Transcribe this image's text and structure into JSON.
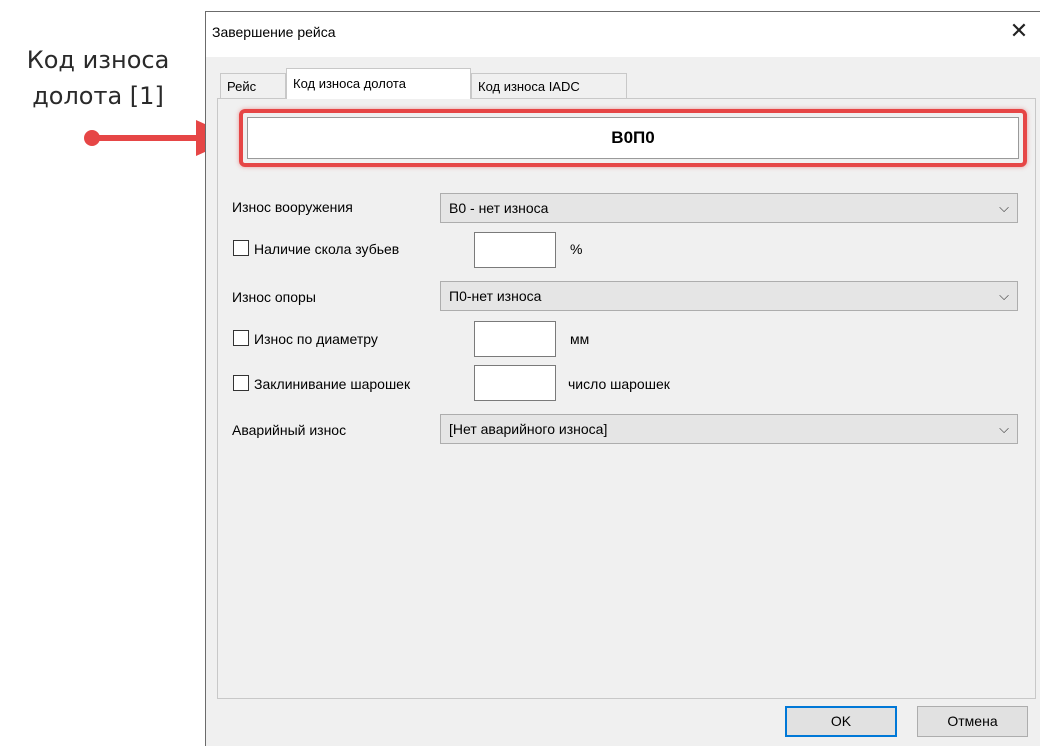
{
  "annotation": {
    "text_line1": "Код износа",
    "text_line2": "долота [1]"
  },
  "dialog": {
    "title": "Завершение рейса",
    "tabs": [
      {
        "label": "Рейс"
      },
      {
        "label": "Код износа долота",
        "active": true
      },
      {
        "label": "Код износа IADC"
      }
    ],
    "code_value": "В0П0",
    "fields": {
      "armament_wear": {
        "label": "Износ вооружения",
        "value": "В0 - нет износа"
      },
      "tooth_chip": {
        "label": "Наличие скола зубьев",
        "value": "",
        "unit": "%"
      },
      "bearing_wear": {
        "label": "Износ опоры",
        "value": "П0-нет износа"
      },
      "diameter_wear": {
        "label": "Износ по диаметру",
        "value": "",
        "unit": "мм"
      },
      "cone_jam": {
        "label": "Заклинивание шарошек",
        "value": "",
        "unit": "число шарошек"
      },
      "emergency_wear": {
        "label": "Аварийный износ",
        "value": "[Нет аварийного износа]"
      }
    },
    "buttons": {
      "ok": "OK",
      "cancel": "Отмена"
    }
  },
  "colors": {
    "highlight": "#e64646",
    "dialog_bg": "#f0f0f0",
    "primary_border": "#0078d7"
  }
}
